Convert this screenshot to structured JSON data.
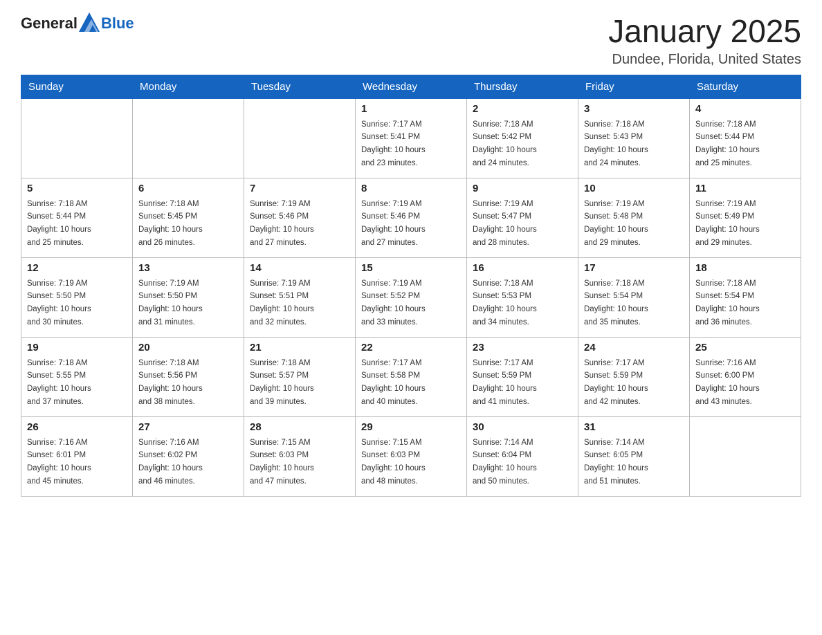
{
  "logo": {
    "general": "General",
    "blue": "Blue"
  },
  "title": "January 2025",
  "location": "Dundee, Florida, United States",
  "weekdays": [
    "Sunday",
    "Monday",
    "Tuesday",
    "Wednesday",
    "Thursday",
    "Friday",
    "Saturday"
  ],
  "weeks": [
    [
      {
        "day": "",
        "info": ""
      },
      {
        "day": "",
        "info": ""
      },
      {
        "day": "",
        "info": ""
      },
      {
        "day": "1",
        "info": "Sunrise: 7:17 AM\nSunset: 5:41 PM\nDaylight: 10 hours\nand 23 minutes."
      },
      {
        "day": "2",
        "info": "Sunrise: 7:18 AM\nSunset: 5:42 PM\nDaylight: 10 hours\nand 24 minutes."
      },
      {
        "day": "3",
        "info": "Sunrise: 7:18 AM\nSunset: 5:43 PM\nDaylight: 10 hours\nand 24 minutes."
      },
      {
        "day": "4",
        "info": "Sunrise: 7:18 AM\nSunset: 5:44 PM\nDaylight: 10 hours\nand 25 minutes."
      }
    ],
    [
      {
        "day": "5",
        "info": "Sunrise: 7:18 AM\nSunset: 5:44 PM\nDaylight: 10 hours\nand 25 minutes."
      },
      {
        "day": "6",
        "info": "Sunrise: 7:18 AM\nSunset: 5:45 PM\nDaylight: 10 hours\nand 26 minutes."
      },
      {
        "day": "7",
        "info": "Sunrise: 7:19 AM\nSunset: 5:46 PM\nDaylight: 10 hours\nand 27 minutes."
      },
      {
        "day": "8",
        "info": "Sunrise: 7:19 AM\nSunset: 5:46 PM\nDaylight: 10 hours\nand 27 minutes."
      },
      {
        "day": "9",
        "info": "Sunrise: 7:19 AM\nSunset: 5:47 PM\nDaylight: 10 hours\nand 28 minutes."
      },
      {
        "day": "10",
        "info": "Sunrise: 7:19 AM\nSunset: 5:48 PM\nDaylight: 10 hours\nand 29 minutes."
      },
      {
        "day": "11",
        "info": "Sunrise: 7:19 AM\nSunset: 5:49 PM\nDaylight: 10 hours\nand 29 minutes."
      }
    ],
    [
      {
        "day": "12",
        "info": "Sunrise: 7:19 AM\nSunset: 5:50 PM\nDaylight: 10 hours\nand 30 minutes."
      },
      {
        "day": "13",
        "info": "Sunrise: 7:19 AM\nSunset: 5:50 PM\nDaylight: 10 hours\nand 31 minutes."
      },
      {
        "day": "14",
        "info": "Sunrise: 7:19 AM\nSunset: 5:51 PM\nDaylight: 10 hours\nand 32 minutes."
      },
      {
        "day": "15",
        "info": "Sunrise: 7:19 AM\nSunset: 5:52 PM\nDaylight: 10 hours\nand 33 minutes."
      },
      {
        "day": "16",
        "info": "Sunrise: 7:18 AM\nSunset: 5:53 PM\nDaylight: 10 hours\nand 34 minutes."
      },
      {
        "day": "17",
        "info": "Sunrise: 7:18 AM\nSunset: 5:54 PM\nDaylight: 10 hours\nand 35 minutes."
      },
      {
        "day": "18",
        "info": "Sunrise: 7:18 AM\nSunset: 5:54 PM\nDaylight: 10 hours\nand 36 minutes."
      }
    ],
    [
      {
        "day": "19",
        "info": "Sunrise: 7:18 AM\nSunset: 5:55 PM\nDaylight: 10 hours\nand 37 minutes."
      },
      {
        "day": "20",
        "info": "Sunrise: 7:18 AM\nSunset: 5:56 PM\nDaylight: 10 hours\nand 38 minutes."
      },
      {
        "day": "21",
        "info": "Sunrise: 7:18 AM\nSunset: 5:57 PM\nDaylight: 10 hours\nand 39 minutes."
      },
      {
        "day": "22",
        "info": "Sunrise: 7:17 AM\nSunset: 5:58 PM\nDaylight: 10 hours\nand 40 minutes."
      },
      {
        "day": "23",
        "info": "Sunrise: 7:17 AM\nSunset: 5:59 PM\nDaylight: 10 hours\nand 41 minutes."
      },
      {
        "day": "24",
        "info": "Sunrise: 7:17 AM\nSunset: 5:59 PM\nDaylight: 10 hours\nand 42 minutes."
      },
      {
        "day": "25",
        "info": "Sunrise: 7:16 AM\nSunset: 6:00 PM\nDaylight: 10 hours\nand 43 minutes."
      }
    ],
    [
      {
        "day": "26",
        "info": "Sunrise: 7:16 AM\nSunset: 6:01 PM\nDaylight: 10 hours\nand 45 minutes."
      },
      {
        "day": "27",
        "info": "Sunrise: 7:16 AM\nSunset: 6:02 PM\nDaylight: 10 hours\nand 46 minutes."
      },
      {
        "day": "28",
        "info": "Sunrise: 7:15 AM\nSunset: 6:03 PM\nDaylight: 10 hours\nand 47 minutes."
      },
      {
        "day": "29",
        "info": "Sunrise: 7:15 AM\nSunset: 6:03 PM\nDaylight: 10 hours\nand 48 minutes."
      },
      {
        "day": "30",
        "info": "Sunrise: 7:14 AM\nSunset: 6:04 PM\nDaylight: 10 hours\nand 50 minutes."
      },
      {
        "day": "31",
        "info": "Sunrise: 7:14 AM\nSunset: 6:05 PM\nDaylight: 10 hours\nand 51 minutes."
      },
      {
        "day": "",
        "info": ""
      }
    ]
  ]
}
